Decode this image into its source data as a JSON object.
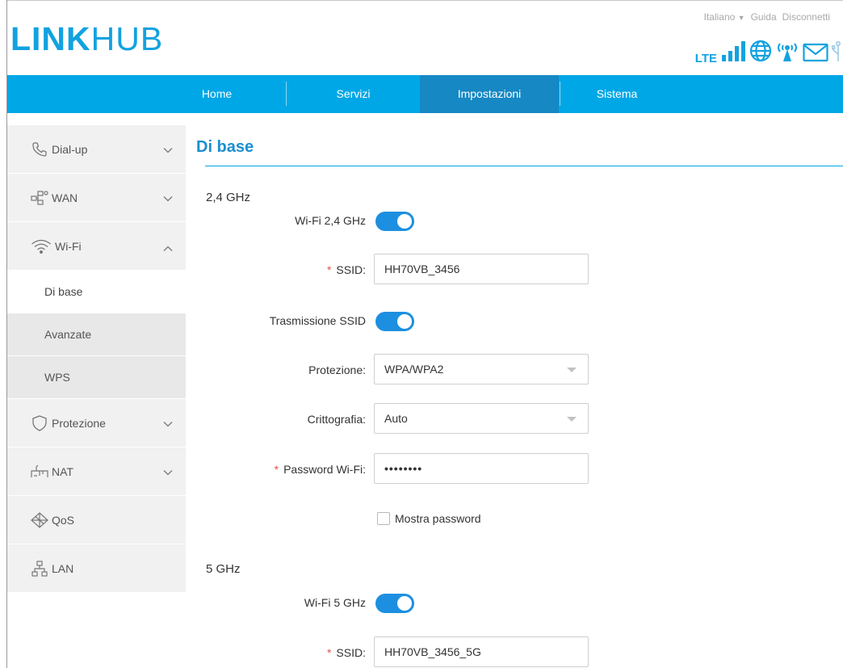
{
  "brand": {
    "bold": "LINK",
    "light": "HUB"
  },
  "top_links": {
    "language": "Italiano",
    "help": "Guida",
    "logout": "Disconnetti"
  },
  "status": {
    "network": "LTE",
    "signal_bars": 4
  },
  "nav": {
    "home": "Home",
    "services": "Servizi",
    "settings": "Impostazioni",
    "system": "Sistema"
  },
  "sidebar": {
    "dialup": "Dial-up",
    "wan": "WAN",
    "wifi": "Wi-Fi",
    "wifi_sub": [
      "Di base",
      "Avanzate",
      "WPS"
    ],
    "security": "Protezione",
    "nat": "NAT",
    "qos": "QoS",
    "lan": "LAN"
  },
  "page": {
    "title": "Di base"
  },
  "band24": {
    "heading": "2,4 GHz",
    "wifi_label": "Wi-Fi 2,4 GHz",
    "wifi_on": true,
    "ssid_label": "SSID:",
    "ssid_value": "HH70VB_3456",
    "broadcast_label": "Trasmissione SSID",
    "broadcast_on": true,
    "security_label": "Protezione:",
    "security_value": "WPA/WPA2",
    "encryption_label": "Crittografia:",
    "encryption_value": "Auto",
    "password_label": "Password Wi-Fi:",
    "password_value": "••••••••",
    "show_password_label": "Mostra password"
  },
  "band5": {
    "heading": "5 GHz",
    "wifi_label": "Wi-Fi 5 GHz",
    "wifi_on": true,
    "ssid_label": "SSID:",
    "ssid_value": "HH70VB_3456_5G"
  },
  "colors": {
    "accent": "#00a7e6",
    "accent_dark": "#1688c4",
    "toggle": "#1d8fe0",
    "required": "#e45050"
  }
}
